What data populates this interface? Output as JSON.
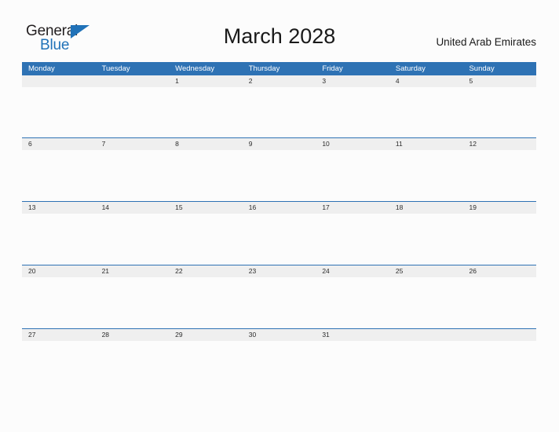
{
  "logo": {
    "text_primary": "General",
    "text_secondary": "Blue",
    "flag_icon": "triangle-flag-icon",
    "color_primary": "#231f20",
    "color_secondary": "#2072b8"
  },
  "header": {
    "title": "March 2028",
    "country": "United Arab Emirates"
  },
  "colors": {
    "header_blue": "#2e72b4",
    "band_gray": "#efefef",
    "page_background": "#fcfcfc",
    "text": "#1a1a1a"
  },
  "calendar": {
    "weekdays": [
      "Monday",
      "Tuesday",
      "Wednesday",
      "Thursday",
      "Friday",
      "Saturday",
      "Sunday"
    ],
    "weeks": [
      [
        "",
        "",
        "1",
        "2",
        "3",
        "4",
        "5"
      ],
      [
        "6",
        "7",
        "8",
        "9",
        "10",
        "11",
        "12"
      ],
      [
        "13",
        "14",
        "15",
        "16",
        "17",
        "18",
        "19"
      ],
      [
        "20",
        "21",
        "22",
        "23",
        "24",
        "25",
        "26"
      ],
      [
        "27",
        "28",
        "29",
        "30",
        "31",
        "",
        ""
      ]
    ]
  }
}
